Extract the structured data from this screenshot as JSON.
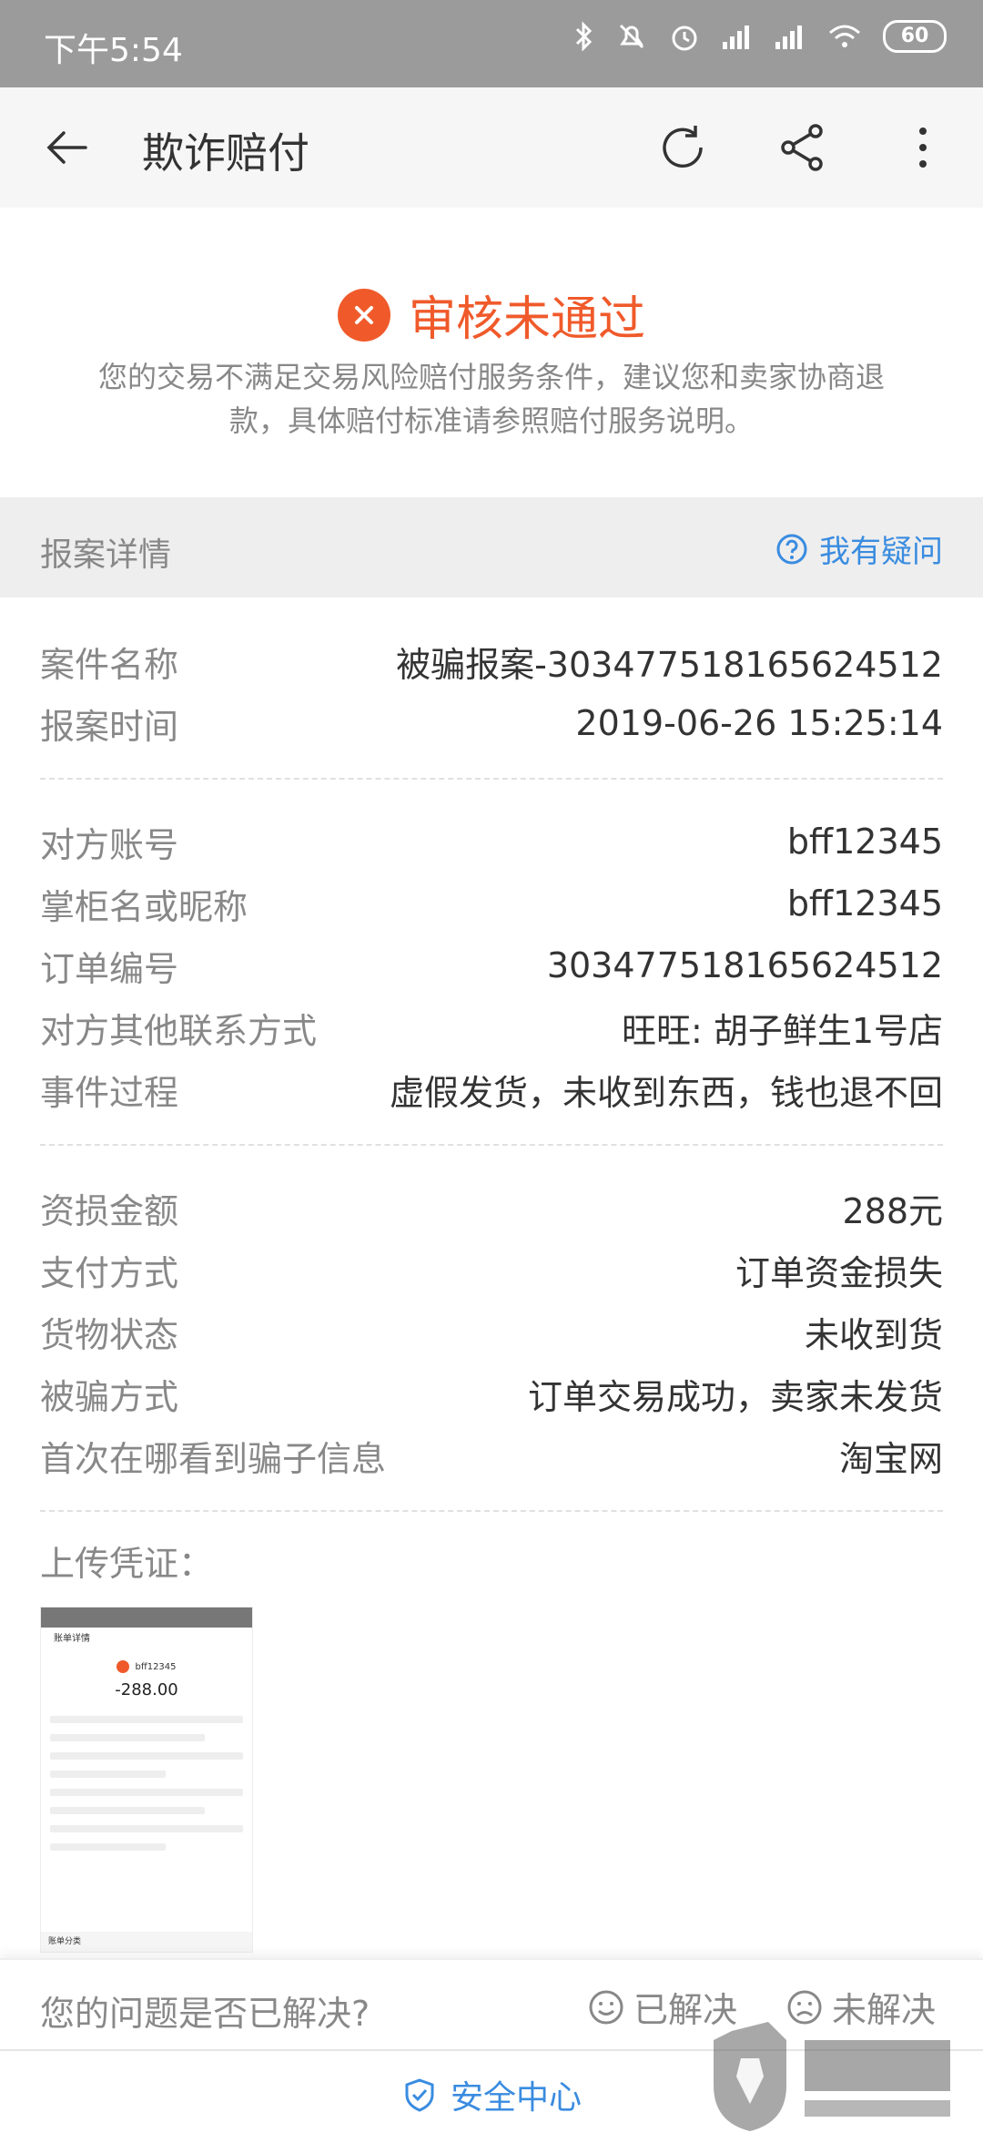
{
  "status_bar": {
    "time": "下午5:54",
    "battery": "60"
  },
  "app_bar": {
    "title": "欺诈赔付"
  },
  "result": {
    "title": "审核未通过",
    "description": "您的交易不满足交易风险赔付服务条件，建议您和卖家协商退款，具体赔付标准请参照赔付服务说明。",
    "status_color": "#f05a2b"
  },
  "section": {
    "label": "报案详情",
    "help_label": "我有疑问"
  },
  "groups": [
    [
      {
        "k": "案件名称",
        "v": "被骗报案-303477518165624512"
      },
      {
        "k": "报案时间",
        "v": "2019-06-26 15:25:14"
      }
    ],
    [
      {
        "k": "对方账号",
        "v": "bff12345"
      },
      {
        "k": "掌柜名或昵称",
        "v": "bff12345"
      },
      {
        "k": "订单编号",
        "v": "303477518165624512"
      },
      {
        "k": "对方其他联系方式",
        "v": "旺旺: 胡子鲜生1号店"
      },
      {
        "k": "事件过程",
        "v": "虚假发货，未收到东西，钱也退不回"
      }
    ],
    [
      {
        "k": "资损金额",
        "v": "288元"
      },
      {
        "k": "支付方式",
        "v": "订单资金损失"
      },
      {
        "k": "货物状态",
        "v": "未收到货"
      },
      {
        "k": "被骗方式",
        "v": "订单交易成功，卖家未发货"
      },
      {
        "k": "首次在哪看到骗子信息",
        "v": "淘宝网"
      }
    ]
  ],
  "upload": {
    "label": "上传凭证：",
    "thumb": {
      "nav": "账单详情",
      "shop": "bff12345",
      "amount": "-288.00",
      "footer": "账单分类"
    }
  },
  "feedback": {
    "question": "您的问题是否已解决?",
    "solved": "已解决",
    "unsolved": "未解决"
  },
  "bottom": {
    "label": "安全中心"
  },
  "accent_color": "#3a8ce0"
}
